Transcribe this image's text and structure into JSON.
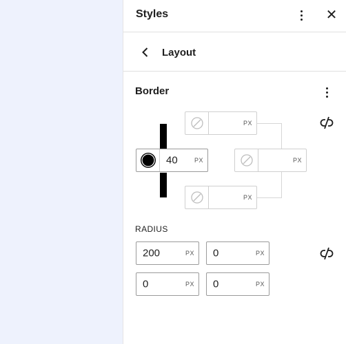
{
  "panel": {
    "title": "Styles"
  },
  "nav": {
    "title": "Layout"
  },
  "border": {
    "title": "Border",
    "unit": "PX",
    "top": {
      "value": ""
    },
    "left": {
      "value": "40"
    },
    "right": {
      "value": ""
    },
    "bottom": {
      "value": ""
    }
  },
  "radius": {
    "label": "RADIUS",
    "unit": "PX",
    "top_left": "200",
    "top_right": "0",
    "bottom_left": "0",
    "bottom_right": "0"
  },
  "icons": {
    "more": "more-vertical-icon",
    "close": "close-icon",
    "back": "chevron-left-icon",
    "unlink": "unlink-icon",
    "empty_color": "no-color-icon",
    "color_swatch": "color-swatch-icon"
  },
  "colors": {
    "canvas_bg": "#eef2fd",
    "border_color": "#000000"
  }
}
